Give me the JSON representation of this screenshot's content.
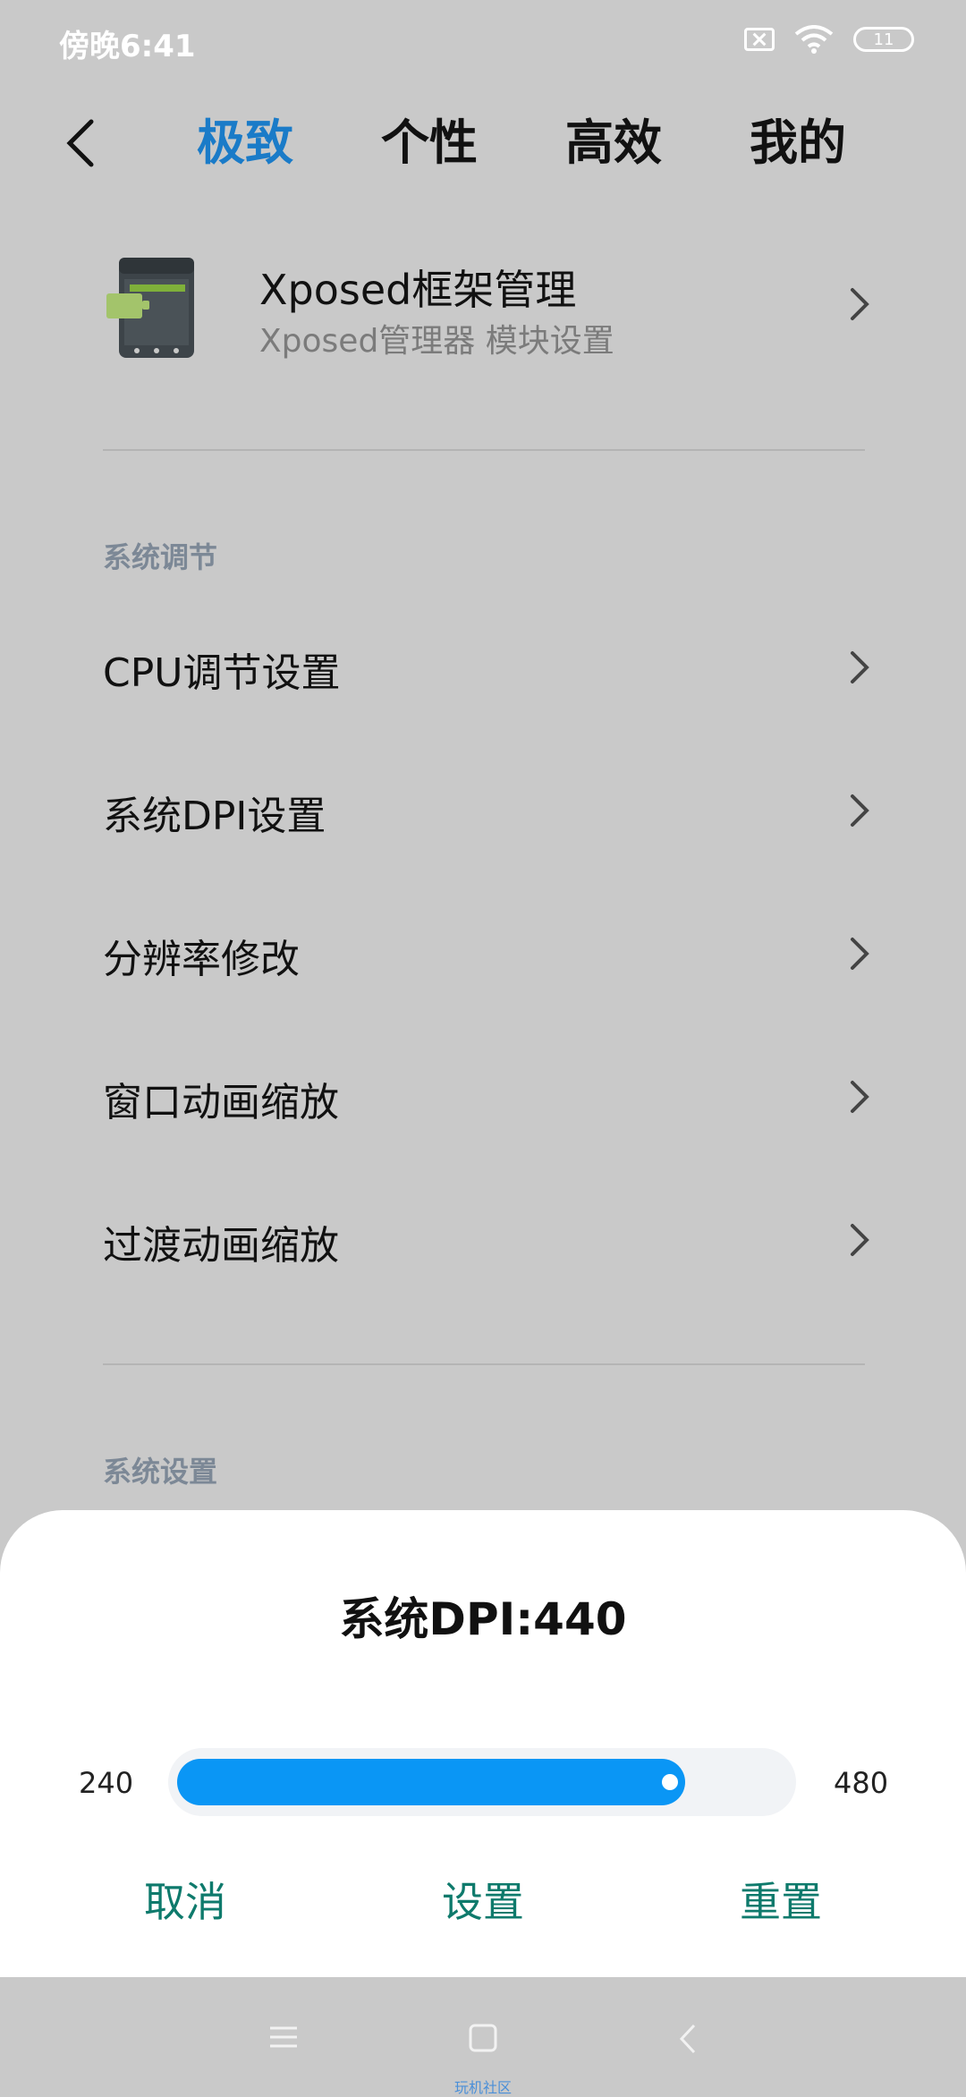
{
  "status_bar": {
    "time": "傍晚6:41",
    "battery": "11"
  },
  "nav": {
    "tabs": [
      {
        "label": "极致",
        "active": true
      },
      {
        "label": "个性",
        "active": false
      },
      {
        "label": "高效",
        "active": false
      },
      {
        "label": "我的",
        "active": false
      }
    ]
  },
  "xposed": {
    "title": "Xposed框架管理",
    "subtitle": "Xposed管理器 模块设置"
  },
  "sections": [
    {
      "header": "系统调节",
      "items": [
        "CPU调节设置",
        "系统DPI设置",
        "分辨率修改",
        "窗口动画缩放",
        "过渡动画缩放"
      ]
    },
    {
      "header": "系统设置",
      "items": []
    }
  ],
  "dialog": {
    "title": "系统DPI:440",
    "slider": {
      "min": 240,
      "max": 480,
      "value": 440,
      "min_label": "240",
      "max_label": "480"
    },
    "buttons": {
      "cancel": "取消",
      "set": "设置",
      "reset": "重置"
    }
  },
  "watermark": "玩机社区",
  "colors": {
    "accent": "#1a7bc8",
    "slider": "#0a96f5",
    "button_text": "#0e7a6c",
    "dim_background": "#c9c9c9"
  }
}
